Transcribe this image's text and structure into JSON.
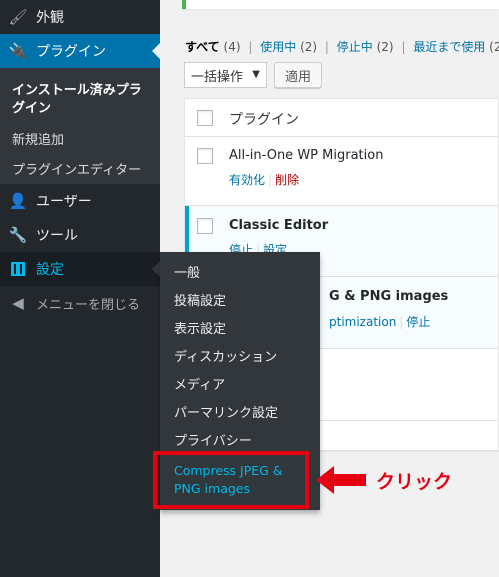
{
  "sidebar": {
    "appearance": "外観",
    "plugins": "プラグイン",
    "plugins_submenu": [
      "インストール済みプラグイン",
      "新規追加",
      "プラグインエディター"
    ],
    "users": "ユーザー",
    "tools": "ツール",
    "settings": "設定",
    "collapse": "メニューを閉じる"
  },
  "settings_flyout": {
    "items": [
      "一般",
      "投稿設定",
      "表示設定",
      "ディスカッション",
      "メディア",
      "パーマリンク設定",
      "プライバシー"
    ],
    "compress_line1": "Compress JPEG &",
    "compress_line2": "PNG images"
  },
  "annotation": {
    "click_label": "クリック",
    "accent_color": "#e60012"
  },
  "filters": {
    "all": "すべて",
    "all_count": "(4)",
    "active": "使用中",
    "active_count": "(2)",
    "inactive": "停止中",
    "inactive_count": "(2)",
    "recent": "最近まで使用",
    "recent_count": "(2"
  },
  "bulk": {
    "select_value": "一括操作",
    "apply_label": "適用"
  },
  "table": {
    "header": "プラグイン",
    "rows": [
      {
        "name": "All-in-One WP Migration",
        "action1": "有効化",
        "action2": "削除"
      },
      {
        "name": "Classic Editor",
        "action1": "停止",
        "action2": "設定"
      },
      {
        "name": "G & PNG images",
        "action1": "ptimization",
        "action2": "停止"
      }
    ]
  },
  "colors": {
    "sidebar": "#23282d",
    "accent": "#0073aa",
    "link": "#0073aa",
    "hover_text": "#00b9eb",
    "active_border": "#00a0d2"
  }
}
